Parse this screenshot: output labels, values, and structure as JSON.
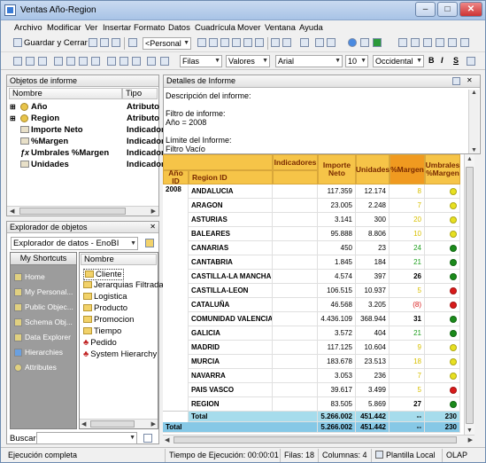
{
  "window": {
    "title": "Ventas Año-Region"
  },
  "menu": [
    "Archivo",
    "Modificar",
    "Ver",
    "Insertar",
    "Formato",
    "Datos",
    "Cuadrícula",
    "Mover",
    "Ventana",
    "Ayuda"
  ],
  "toolbar1": {
    "save_close": "Guardar y Cerrar",
    "personal": "<Personal"
  },
  "toolbar2": {
    "filas": "Filas",
    "valores": "Valores",
    "font": "Arial",
    "size": "10",
    "region": "Occidental",
    "bold": "B",
    "italic": "I",
    "underline": "S"
  },
  "objects_panel": {
    "title": "Objetos de informe",
    "col_name": "Nombre",
    "col_type": "Tipo",
    "items": [
      {
        "name": "Año",
        "type": "Atributo"
      },
      {
        "name": "Region",
        "type": "Atributo"
      },
      {
        "name": "Importe Neto",
        "type": "Indicador"
      },
      {
        "name": "%Margen",
        "type": "Indicador"
      },
      {
        "name": "Umbrales %Margen",
        "type": "Indicador"
      },
      {
        "name": "Unidades",
        "type": "Indicador"
      }
    ]
  },
  "explorer_panel": {
    "title": "Explorador de objetos",
    "selector": "Explorador de datos - EnoBI",
    "shortcuts_header": "My Shortcuts",
    "shortcuts": [
      "Home",
      "My Personal...",
      "Public Objec...",
      "Schema Obj...",
      "Data Explorer",
      "Hierarchies",
      "Attributes"
    ],
    "tree_header": "Nombre",
    "tree": [
      "Cliente",
      "Jerarquias Filtradas",
      "Logistica",
      "Producto",
      "Promocion",
      "Tiempo",
      "Pedido",
      "System Hierarchy"
    ],
    "search_label": "Buscar:"
  },
  "details_panel": {
    "title": "Detalles de Informe",
    "desc_label": "Descripción del informe:",
    "filter_label": "Filtro de informe:",
    "filter_value": "Año = 2008",
    "limit_label": "Límite del Informe:",
    "limit_value": "Filtro Vacío"
  },
  "grid": {
    "headers": {
      "indicadores": "Indicadores",
      "anio": "Año ID",
      "region": "Region ID",
      "importe": "Importe Neto",
      "unidades": "Unidades",
      "margen": "%Margen",
      "umbrales": "Umbrales %Margen"
    },
    "year": "2008",
    "rows": [
      {
        "region": "ANDALUCIA",
        "importe": "117.359",
        "unidades": "12.174",
        "margen": "8",
        "dot": "#e8e020",
        "mcolor": "#d8c000",
        "mbold": false
      },
      {
        "region": "ARAGON",
        "importe": "23.005",
        "unidades": "2.248",
        "margen": "7",
        "dot": "#e8e020",
        "mcolor": "#d8c000",
        "mbold": false
      },
      {
        "region": "ASTURIAS",
        "importe": "3.141",
        "unidades": "300",
        "margen": "20",
        "dot": "#e8e020",
        "mcolor": "#d8c000",
        "mbold": false
      },
      {
        "region": "BALEARES",
        "importe": "95.888",
        "unidades": "8.806",
        "margen": "10",
        "dot": "#e8e020",
        "mcolor": "#d8c000",
        "mbold": false
      },
      {
        "region": "CANARIAS",
        "importe": "450",
        "unidades": "23",
        "margen": "24",
        "dot": "#1a8a1a",
        "mcolor": "#20a020",
        "mbold": false
      },
      {
        "region": "CANTABRIA",
        "importe": "1.845",
        "unidades": "184",
        "margen": "21",
        "dot": "#1a8a1a",
        "mcolor": "#20a020",
        "mbold": false
      },
      {
        "region": "CASTILLA-LA MANCHA",
        "importe": "4.574",
        "unidades": "397",
        "margen": "26",
        "dot": "#1a8a1a",
        "mcolor": "#000",
        "mbold": true
      },
      {
        "region": "CASTILLA-LEON",
        "importe": "106.515",
        "unidades": "10.937",
        "margen": "5",
        "dot": "#d81a1a",
        "mcolor": "#d8c000",
        "mbold": false
      },
      {
        "region": "CATALUÑA",
        "importe": "46.568",
        "unidades": "3.205",
        "margen": "(8)",
        "dot": "#d81a1a",
        "mcolor": "#d81a1a",
        "mbold": false
      },
      {
        "region": "COMUNIDAD VALENCIA",
        "importe": "4.436.109",
        "unidades": "368.944",
        "margen": "31",
        "dot": "#1a8a1a",
        "mcolor": "#000",
        "mbold": true
      },
      {
        "region": "GALICIA",
        "importe": "3.572",
        "unidades": "404",
        "margen": "21",
        "dot": "#1a8a1a",
        "mcolor": "#20a020",
        "mbold": false
      },
      {
        "region": "MADRID",
        "importe": "117.125",
        "unidades": "10.604",
        "margen": "9",
        "dot": "#e8e020",
        "mcolor": "#d8c000",
        "mbold": false
      },
      {
        "region": "MURCIA",
        "importe": "183.678",
        "unidades": "23.513",
        "margen": "18",
        "dot": "#e8e020",
        "mcolor": "#d8c000",
        "mbold": false
      },
      {
        "region": "NAVARRA",
        "importe": "3.053",
        "unidades": "236",
        "margen": "7",
        "dot": "#e8e020",
        "mcolor": "#d8c000",
        "mbold": false
      },
      {
        "region": "PAIS VASCO",
        "importe": "39.617",
        "unidades": "3.499",
        "margen": "5",
        "dot": "#d81a1a",
        "mcolor": "#d8c000",
        "mbold": false
      },
      {
        "region": "REGION",
        "importe": "83.505",
        "unidades": "5.869",
        "margen": "27",
        "dot": "#1a8a1a",
        "mcolor": "#000",
        "mbold": true
      }
    ],
    "total_label": "Total",
    "total": {
      "importe": "5.266.002",
      "unidades": "451.442",
      "margen": "--",
      "umbrales": "230"
    },
    "grand_label": "Total",
    "grand": {
      "importe": "5.266.002",
      "unidades": "451.442",
      "margen": "--",
      "umbrales": "230"
    }
  },
  "status": {
    "state": "Ejecución completa",
    "time": "Tiempo de Ejecución: 00:00:01",
    "rows": "Filas: 18",
    "cols": "Columnas: 4",
    "template": "Plantilla Local",
    "mode": "OLAP"
  }
}
